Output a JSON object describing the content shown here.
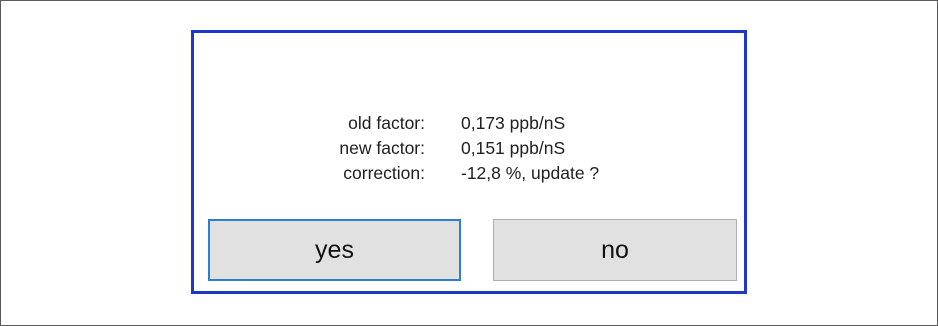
{
  "dialog": {
    "rows": [
      {
        "label": "old factor:",
        "value": "0,173 ppb/nS"
      },
      {
        "label": "new factor:",
        "value": "0,151 ppb/nS"
      },
      {
        "label": "correction:",
        "value": "-12,8 %, update ?"
      }
    ],
    "buttons": {
      "yes_label": "yes",
      "no_label": "no"
    }
  },
  "colors": {
    "dialog_border": "#1f37c8",
    "button_face": "#e1e1e1",
    "focused_button_border": "#2b7fd2"
  }
}
